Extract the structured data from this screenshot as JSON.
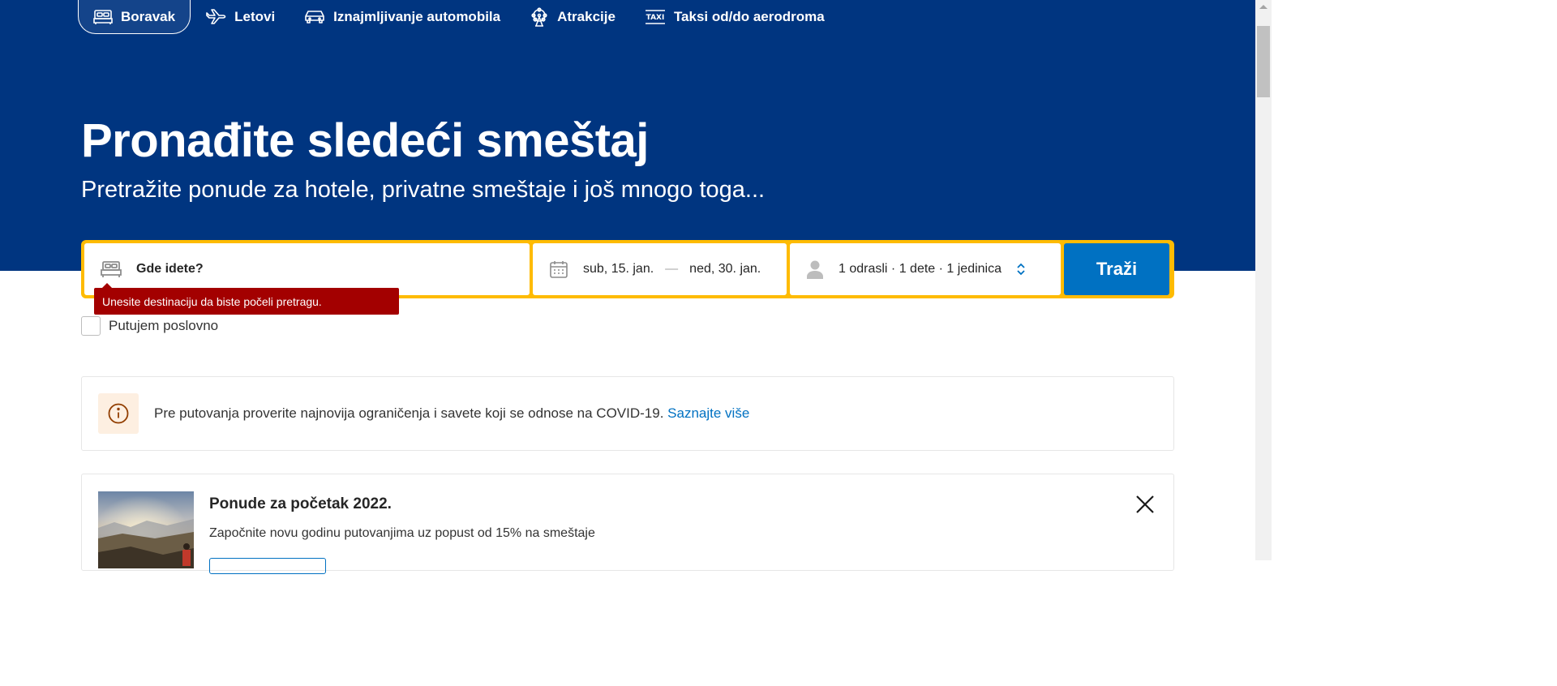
{
  "nav": {
    "items": [
      {
        "label": "Boravak",
        "icon": "bed-icon",
        "active": true
      },
      {
        "label": "Letovi",
        "icon": "plane-icon",
        "active": false
      },
      {
        "label": "Iznajmljivanje automobila",
        "icon": "car-icon",
        "active": false
      },
      {
        "label": "Atrakcije",
        "icon": "ferris-wheel-icon",
        "active": false
      },
      {
        "label": "Taksi od/do aerodroma",
        "icon": "taxi-icon",
        "active": false
      }
    ]
  },
  "hero": {
    "title": "Pronađite sledeći smeštaj",
    "subtitle": "Pretražite ponude za hotele, privatne smeštaje i još mnogo toga..."
  },
  "search": {
    "destination_placeholder": "Gde idete?",
    "checkin": "sub, 15. jan.",
    "date_separator": "—",
    "checkout": "ned, 30. jan.",
    "guests": "1 odrasli  ·  1 dete  ·  1 jedinica",
    "button_label": "Traži",
    "error": "Unesite destinaciju da biste počeli pretragu."
  },
  "business": {
    "label": "Putujem poslovno",
    "checked": false
  },
  "covid": {
    "text": "Pre putovanja proverite najnovija ograničenja i savete koji se odnose na COVID-19.",
    "link": "Saznajte više"
  },
  "promo": {
    "title": "Ponude za početak 2022.",
    "description": "Započnite novu godinu putovanjima uz popust od 15% na smeštaje"
  },
  "colors": {
    "brand_blue": "#003580",
    "accent_yellow": "#febb02",
    "button_blue": "#0071c2",
    "error_red": "#a30000"
  }
}
